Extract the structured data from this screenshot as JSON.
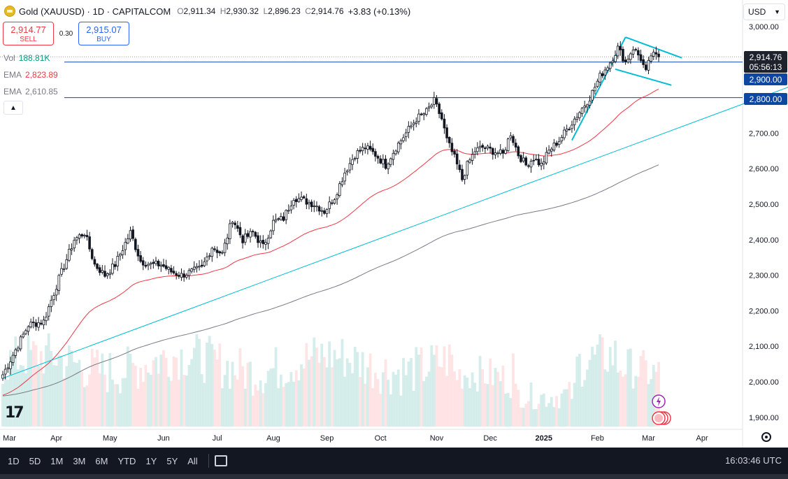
{
  "header": {
    "title": "Gold (XAUUSD) · 1D · CAPITALCOM",
    "open_label": "O",
    "open": "2,911.34",
    "high_label": "H",
    "high": "2,930.32",
    "low_label": "L",
    "low": "2,896.23",
    "close_label": "C",
    "close": "2,914.76",
    "change": "+3.83 (+0.13%)"
  },
  "trade": {
    "sell_price": "2,914.77",
    "sell_label": "SELL",
    "spread": "0.30",
    "buy_price": "2,915.07",
    "buy_label": "BUY"
  },
  "indicators": {
    "vol_label": "Vol",
    "vol_value": "188.81K",
    "ema1_label": "EMA",
    "ema1_value": "2,823.89",
    "ema2_label": "EMA",
    "ema2_value": "2,610.85"
  },
  "currency": "USD",
  "price_tag": {
    "price": "2,914.76",
    "countdown": "05:56:13"
  },
  "level_tags": [
    "2,900.00",
    "2,800.00"
  ],
  "range_buttons": [
    "1D",
    "5D",
    "1M",
    "3M",
    "6M",
    "YTD",
    "1Y",
    "5Y",
    "All"
  ],
  "clock": "16:03:46 UTC",
  "colors": {
    "up": "#089981",
    "down": "#f23645",
    "ema_fast": "#f23645",
    "ema_slow": "#787b86",
    "trendline": "#00bcd4",
    "hline": "#0d47a1",
    "vol_up": "#b2dfdb",
    "vol_down": "#ffcdd2"
  },
  "chart_data": {
    "type": "candlestick",
    "symbol": "XAUUSD",
    "timeframe": "1D",
    "y_ticks": [
      "3,000.00",
      "2,900.00",
      "2,800.00",
      "2,700.00",
      "2,600.00",
      "2,500.00",
      "2,400.00",
      "2,300.00",
      "2,200.00",
      "2,100.00",
      "2,000.00",
      "1,900.00"
    ],
    "y_tick_values": [
      3000,
      2900,
      2800,
      2700,
      2600,
      2500,
      2400,
      2300,
      2200,
      2100,
      2000,
      1900
    ],
    "ylim": [
      1875,
      3030
    ],
    "x_ticks": [
      "Mar",
      "Apr",
      "May",
      "Jun",
      "Jul",
      "Aug",
      "Sep",
      "Oct",
      "Nov",
      "Dec",
      "2025",
      "Feb",
      "Mar",
      "Apr"
    ],
    "x_tick_positions": [
      0,
      21,
      42,
      63,
      84,
      106,
      127,
      148,
      170,
      191,
      212,
      233,
      253,
      274
    ],
    "bars_visible": 258,
    "close_anchors": [
      [
        0,
        2020
      ],
      [
        10,
        2160
      ],
      [
        16,
        2170
      ],
      [
        22,
        2290
      ],
      [
        28,
        2400
      ],
      [
        32,
        2420
      ],
      [
        36,
        2330
      ],
      [
        40,
        2300
      ],
      [
        44,
        2330
      ],
      [
        50,
        2420
      ],
      [
        54,
        2340
      ],
      [
        58,
        2330
      ],
      [
        62,
        2330
      ],
      [
        66,
        2310
      ],
      [
        70,
        2300
      ],
      [
        74,
        2310
      ],
      [
        78,
        2320
      ],
      [
        82,
        2380
      ],
      [
        86,
        2360
      ],
      [
        90,
        2460
      ],
      [
        94,
        2400
      ],
      [
        98,
        2420
      ],
      [
        102,
        2380
      ],
      [
        106,
        2450
      ],
      [
        110,
        2460
      ],
      [
        114,
        2520
      ],
      [
        118,
        2510
      ],
      [
        122,
        2500
      ],
      [
        126,
        2480
      ],
      [
        130,
        2520
      ],
      [
        134,
        2590
      ],
      [
        138,
        2640
      ],
      [
        142,
        2660
      ],
      [
        146,
        2640
      ],
      [
        150,
        2610
      ],
      [
        154,
        2660
      ],
      [
        158,
        2700
      ],
      [
        162,
        2740
      ],
      [
        166,
        2760
      ],
      [
        169,
        2790
      ],
      [
        172,
        2740
      ],
      [
        174,
        2680
      ],
      [
        177,
        2630
      ],
      [
        180,
        2570
      ],
      [
        182,
        2610
      ],
      [
        185,
        2650
      ],
      [
        188,
        2660
      ],
      [
        192,
        2650
      ],
      [
        196,
        2640
      ],
      [
        199,
        2700
      ],
      [
        202,
        2640
      ],
      [
        205,
        2610
      ],
      [
        208,
        2630
      ],
      [
        211,
        2610
      ],
      [
        214,
        2650
      ],
      [
        218,
        2680
      ],
      [
        222,
        2720
      ],
      [
        226,
        2760
      ],
      [
        230,
        2800
      ],
      [
        234,
        2860
      ],
      [
        238,
        2900
      ],
      [
        241,
        2940
      ],
      [
        244,
        2900
      ],
      [
        247,
        2940
      ],
      [
        250,
        2910
      ],
      [
        252,
        2870
      ],
      [
        254,
        2920
      ],
      [
        257,
        2914
      ]
    ],
    "ema_fast_final": 2823.89,
    "ema_slow_final": 2610.85,
    "last_close": 2914.76,
    "horizontal_levels": [
      2900,
      2800
    ],
    "trendlines": [
      {
        "from": [
          0,
          2010
        ],
        "to": [
          308,
          2830
        ]
      },
      {
        "from": [
          223,
          2680
        ],
        "to": [
          244,
          2970
        ]
      },
      {
        "from": [
          244,
          2970
        ],
        "to": [
          266,
          2912
        ]
      },
      {
        "from": [
          240,
          2880
        ],
        "to": [
          262,
          2835
        ]
      }
    ]
  }
}
